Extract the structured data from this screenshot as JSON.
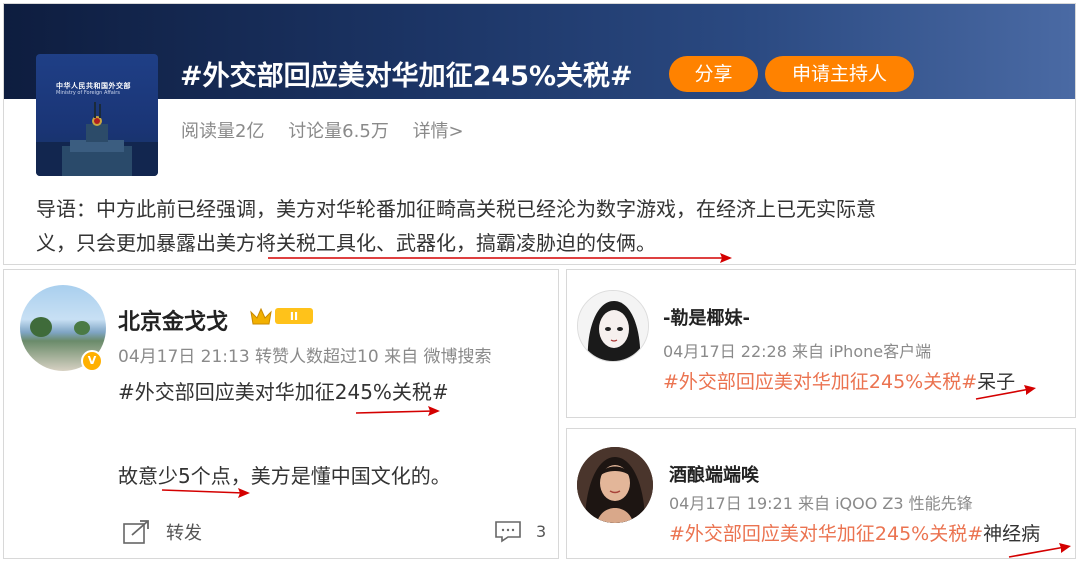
{
  "topic": {
    "title": "#外交部回应美对华加征245%关税#",
    "share_label": "分享",
    "host_label": "申请主持人",
    "reads": "阅读量2亿",
    "discussions": "讨论量6.5万",
    "detail_label": "详情>",
    "avatar_title": "中华人民共和国外交部",
    "avatar_subtitle": "Ministry of Foreign Affairs",
    "guide_line1": "导语：中方此前已经强调，美方对华轮番加征畸高关税已经沦为数字游戏，在经济上已无实际意",
    "guide_line2": "义，只会更加暴露出美方将关税工具化、武器化，搞霸凌胁迫的伎俩。"
  },
  "posts": {
    "main": {
      "user": "北京金戈戈",
      "level_badge": "II",
      "meta": "04月17日 21:13 转赞人数超过10  来自 微博搜索",
      "topic_tag": "#外交部回应美对华加征245%关税#",
      "text": "故意少5个点，美方是懂中国文化的。",
      "repost_label": "转发",
      "comment_count": "3"
    },
    "reply1": {
      "user": "-勒是椰妹-",
      "meta": "04月17日 22:28  来自 iPhone客户端",
      "topic_tag": "#外交部回应美对华加征245%关税#",
      "text": "呆子"
    },
    "reply2": {
      "user": "酒酿端端唉",
      "meta": "04月17日 19:21  来自 iQOO Z3 性能先锋",
      "topic_tag": "#外交部回应美对华加征245%关税#",
      "text": "神经病"
    }
  },
  "colors": {
    "accent_orange": "#ff8200",
    "topic_link": "#eb7350",
    "annotation_red": "#d40000",
    "banner_dark": "#0e1d3f"
  }
}
